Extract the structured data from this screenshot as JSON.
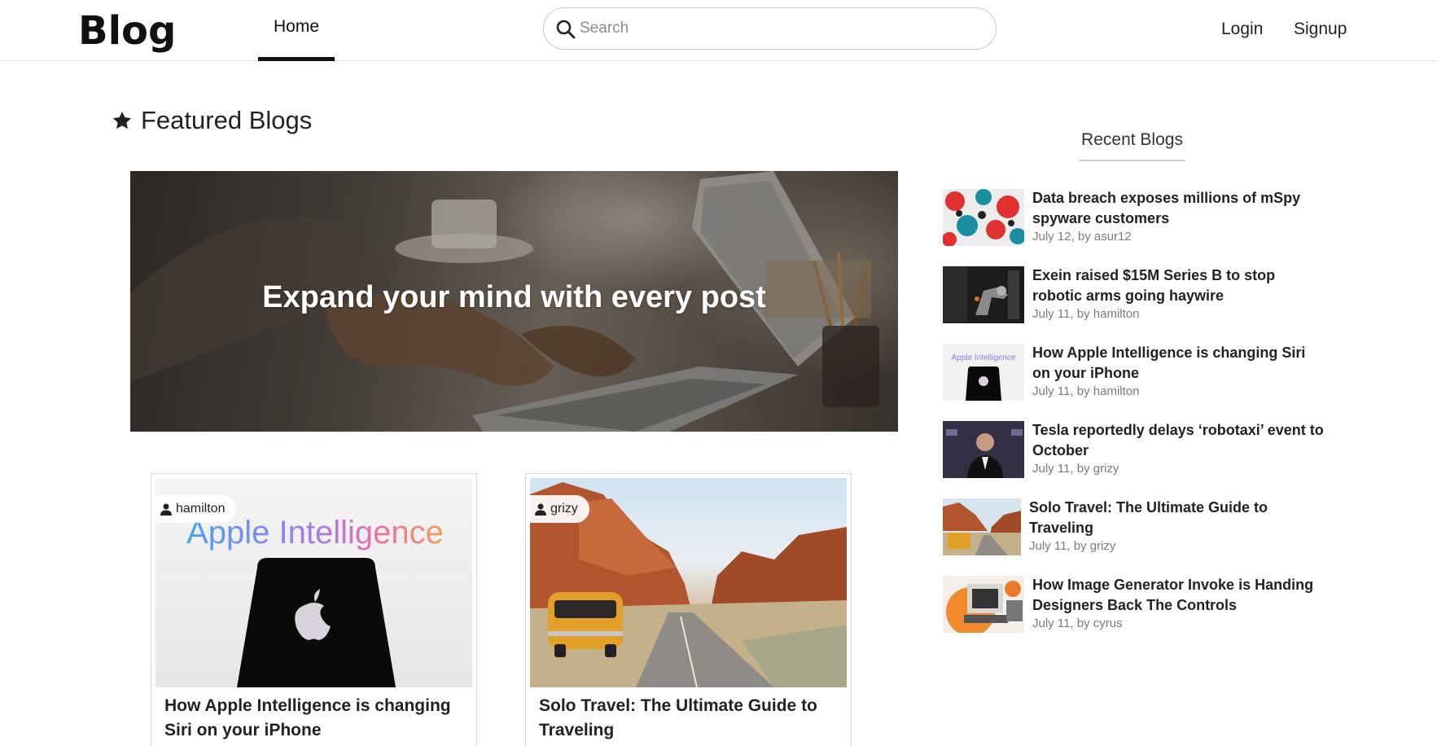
{
  "header": {
    "logo": "Blog",
    "nav_home": "Home",
    "search_placeholder": "Search",
    "login": "Login",
    "signup": "Signup"
  },
  "featured": {
    "heading": "Featured Blogs",
    "hero_text": "Expand your mind with every post",
    "cards": [
      {
        "author": "hamilton",
        "title": "How Apple Intelligence is changing Siri on your iPhone",
        "image_text": "Apple Intelligence"
      },
      {
        "author": "grizy",
        "title": "Solo Travel: The Ultimate Guide to Traveling"
      }
    ]
  },
  "recent": {
    "heading": "Recent Blogs",
    "items": [
      {
        "title": "Data breach exposes millions of mSpy spyware customers",
        "meta": "July 12, by asur12"
      },
      {
        "title": "Exein raised $15M Series B to stop robotic arms going haywire",
        "meta": "July 11, by hamilton"
      },
      {
        "title": "How Apple Intelligence is changing Siri on your iPhone",
        "meta": "July 11, by hamilton",
        "image_text": "Apple Intelligence"
      },
      {
        "title": "Tesla reportedly delays ‘robotaxi’ event to October",
        "meta": "July 11, by grizy"
      },
      {
        "title": "Solo Travel: The Ultimate Guide to Traveling",
        "meta": "July 11, by grizy"
      },
      {
        "title": "How Image Generator Invoke is Handing Designers Back The Controls",
        "meta": "July 11, by cyrus"
      }
    ]
  },
  "colors": {
    "text": "#222222",
    "muted": "#7a7a7a",
    "border": "#d6d6d6",
    "accent": "#111111"
  }
}
